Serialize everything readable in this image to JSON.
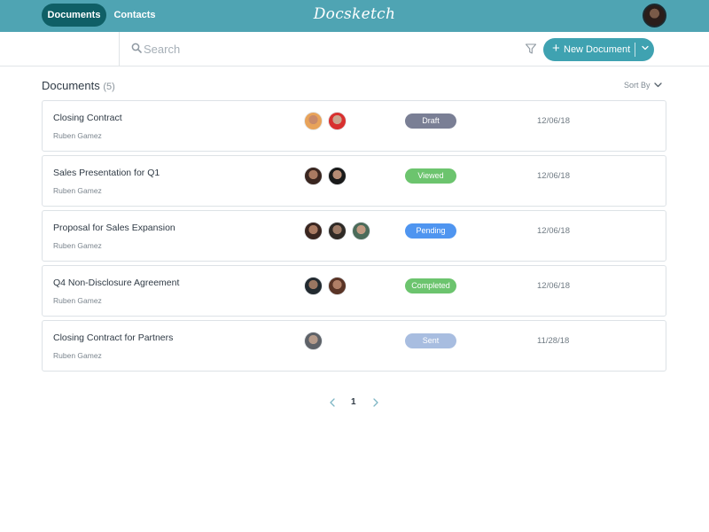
{
  "topbar": {
    "nav": [
      {
        "label": "Documents",
        "active": true
      },
      {
        "label": "Contacts",
        "active": false
      }
    ],
    "logo": "Docsketch",
    "accent_color": "#4fa4b3",
    "active_pill_color": "#0f5f66"
  },
  "toolbar": {
    "search_placeholder": "Search",
    "search_value": "",
    "new_document_label": "New Document",
    "icons": [
      "search-icon",
      "filter-icon",
      "plus-icon",
      "chevron-down-icon"
    ]
  },
  "list": {
    "title": "Documents",
    "count": "(5)",
    "sort_label": "Sort By"
  },
  "documents": [
    {
      "name": "Closing Contract",
      "owner": "Ruben Gamez",
      "status": "Draft",
      "status_color": "#7a7f95",
      "date": "12/06/18",
      "avatars": [
        {
          "bg": "#e8a35a",
          "face": "#c98a6a"
        },
        {
          "bg": "#d8302f",
          "face": "#caa58f"
        }
      ]
    },
    {
      "name": "Sales Presentation for Q1",
      "owner": "Ruben Gamez",
      "status": "Viewed",
      "status_color": "#6cc46e",
      "date": "12/06/18",
      "avatars": [
        {
          "bg": "#3a2620",
          "face": "#a97a62"
        },
        {
          "bg": "#1a1a1a",
          "face": "#b68b74"
        }
      ]
    },
    {
      "name": "Proposal for Sales Expansion",
      "owner": "Ruben Gamez",
      "status": "Pending",
      "status_color": "#4f95f0",
      "date": "12/06/18",
      "avatars": [
        {
          "bg": "#3a2620",
          "face": "#a97a62"
        },
        {
          "bg": "#2f2a26",
          "face": "#9c7a66"
        },
        {
          "bg": "#4b6b5a",
          "face": "#c09a82"
        }
      ]
    },
    {
      "name": "Q4 Non-Disclosure Agreement",
      "owner": "Ruben Gamez",
      "status": "Completed",
      "status_color": "#6cc46e",
      "date": "12/06/18",
      "avatars": [
        {
          "bg": "#222a30",
          "face": "#9a7662"
        },
        {
          "bg": "#5a3426",
          "face": "#b07e66"
        }
      ]
    },
    {
      "name": "Closing Contract for Partners",
      "owner": "Ruben Gamez",
      "status": "Sent",
      "status_color": "#a8bde0",
      "date": "11/28/18",
      "avatars": [
        {
          "bg": "#5e6268",
          "face": "#b49a8a"
        }
      ]
    }
  ],
  "pagination": {
    "current_page": "1"
  }
}
